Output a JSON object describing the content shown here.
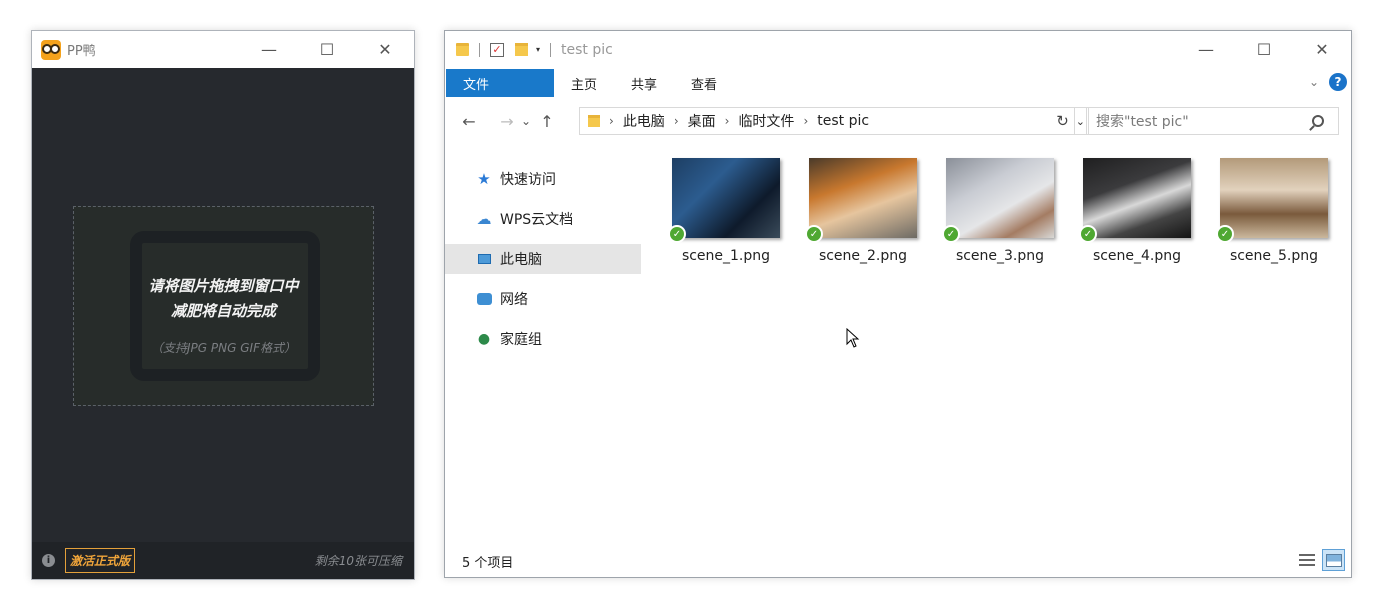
{
  "pp_window": {
    "title": "PP鸭",
    "controls": {
      "minimize": "—",
      "maximize": "☐",
      "close": "✕"
    },
    "drop_zone": {
      "line1": "请将图片拖拽到窗口中",
      "line2": "减肥将自动完成",
      "hint": "（支持JPG PNG GIF格式）"
    },
    "footer": {
      "info_icon": "i",
      "activate_label": "激活正式版",
      "remaining": "剩余10张可压缩"
    },
    "colors": {
      "accent": "#f0a53a",
      "background": "#26292e"
    }
  },
  "explorer": {
    "title": "test pic",
    "qa_dropdown": "▾",
    "controls": {
      "minimize": "—",
      "maximize": "☐",
      "close": "✕"
    },
    "ribbon": {
      "tabs": [
        "文件",
        "主页",
        "共享",
        "查看"
      ],
      "expand_icon": "⌄",
      "help_icon": "?"
    },
    "nav": {
      "back": "←",
      "forward": "→",
      "recent": "⌄",
      "up": "↑",
      "refresh": "↻",
      "address_dropdown": "⌄"
    },
    "breadcrumb": [
      "此电脑",
      "桌面",
      "临时文件",
      "test pic"
    ],
    "crumb_sep": "›",
    "search_placeholder": "搜索\"test pic\"",
    "sidebar": [
      {
        "label": "快速访问",
        "icon": "star-icon"
      },
      {
        "label": "WPS云文档",
        "icon": "cloud-icon"
      },
      {
        "label": "此电脑",
        "icon": "computer-icon",
        "selected": true
      },
      {
        "label": "网络",
        "icon": "network-icon"
      },
      {
        "label": "家庭组",
        "icon": "homegroup-icon"
      }
    ],
    "files": [
      {
        "name": "scene_1.png",
        "status": "✓"
      },
      {
        "name": "scene_2.png",
        "status": "✓"
      },
      {
        "name": "scene_3.png",
        "status": "✓"
      },
      {
        "name": "scene_4.png",
        "status": "✓"
      },
      {
        "name": "scene_5.png",
        "status": "✓"
      }
    ],
    "status_bar": {
      "item_count": "5 个项目"
    },
    "colors": {
      "ribbon_file_tab": "#1979ca",
      "sync_ok": "#4fa832"
    }
  }
}
